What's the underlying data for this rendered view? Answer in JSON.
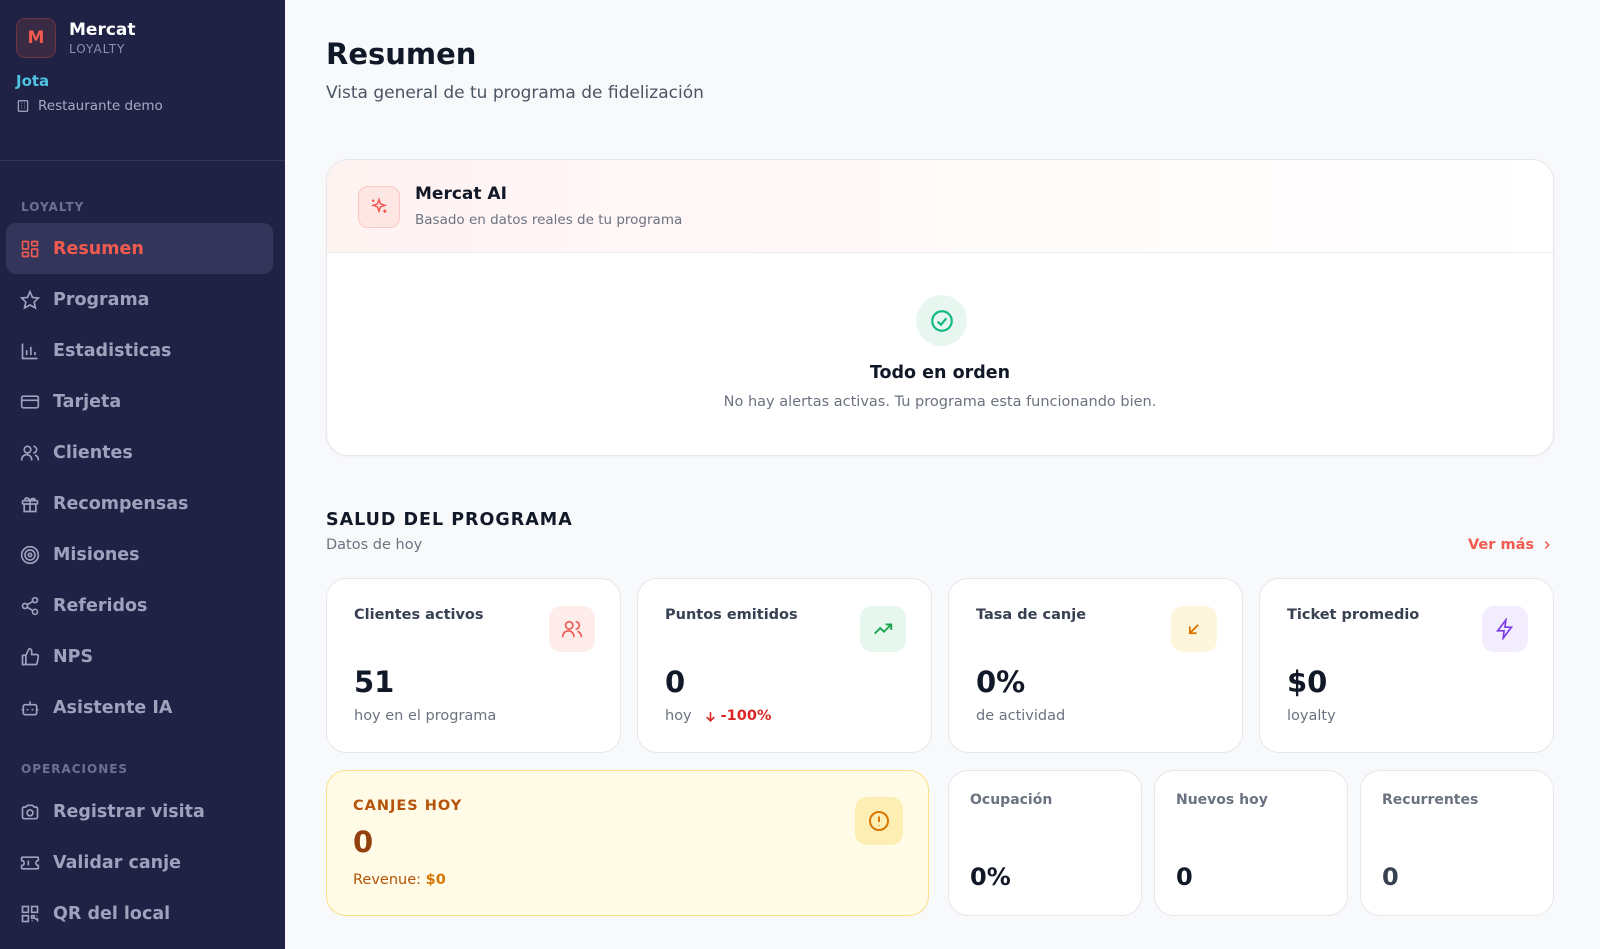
{
  "brand": {
    "initial": "M",
    "name": "Mercat",
    "sub": "LOYALTY"
  },
  "user": {
    "name": "Jota",
    "store": "Restaurante demo"
  },
  "nav": {
    "section_loyalty": "LOYALTY",
    "section_operaciones": "OPERACIONES",
    "loyalty_items": [
      {
        "label": "Resumen",
        "icon": "grid-icon",
        "active": true
      },
      {
        "label": "Programa",
        "icon": "star-icon"
      },
      {
        "label": "Estadisticas",
        "icon": "bar-chart-icon"
      },
      {
        "label": "Tarjeta",
        "icon": "credit-card-icon"
      },
      {
        "label": "Clientes",
        "icon": "users-icon"
      },
      {
        "label": "Recompensas",
        "icon": "gift-icon"
      },
      {
        "label": "Misiones",
        "icon": "target-icon"
      },
      {
        "label": "Referidos",
        "icon": "share-icon"
      },
      {
        "label": "NPS",
        "icon": "thumbs-up-icon"
      },
      {
        "label": "Asistente IA",
        "icon": "bot-icon"
      }
    ],
    "operaciones_items": [
      {
        "label": "Registrar visita",
        "icon": "camera-icon"
      },
      {
        "label": "Validar canje",
        "icon": "ticket-icon"
      },
      {
        "label": "QR del local",
        "icon": "qr-icon"
      }
    ]
  },
  "header": {
    "title": "Resumen",
    "subtitle": "Vista general de tu programa de fidelización"
  },
  "ai": {
    "title": "Mercat AI",
    "subtitle": "Basado en datos reales de tu programa",
    "status_title": "Todo en orden",
    "status_message": "No hay alertas activas. Tu programa esta funcionando bien."
  },
  "health": {
    "title": "SALUD DEL PROGRAMA",
    "subtitle": "Datos de hoy",
    "more_label": "Ver más",
    "stats": [
      {
        "label": "Clientes activos",
        "value": "51",
        "note": "hoy en el programa",
        "icon": "users-icon"
      },
      {
        "label": "Puntos emitidos",
        "value": "0",
        "note": "hoy",
        "delta": "-100%",
        "icon": "trending-up-icon"
      },
      {
        "label": "Tasa de canje",
        "value": "0%",
        "note": "de actividad",
        "icon": "arrow-down-left-icon"
      },
      {
        "label": "Ticket promedio",
        "value": "$0",
        "note": "loyalty",
        "icon": "zap-icon"
      }
    ],
    "canjes": {
      "label": "CANJES HOY",
      "value": "0",
      "revenue_label": "Revenue:",
      "revenue_value": "$0",
      "icon": "alert-circle-icon"
    },
    "mini": [
      {
        "label": "Ocupación",
        "value": "0%"
      },
      {
        "label": "Nuevos hoy",
        "value": "0"
      },
      {
        "label": "Recurrentes",
        "value": "0"
      }
    ]
  }
}
